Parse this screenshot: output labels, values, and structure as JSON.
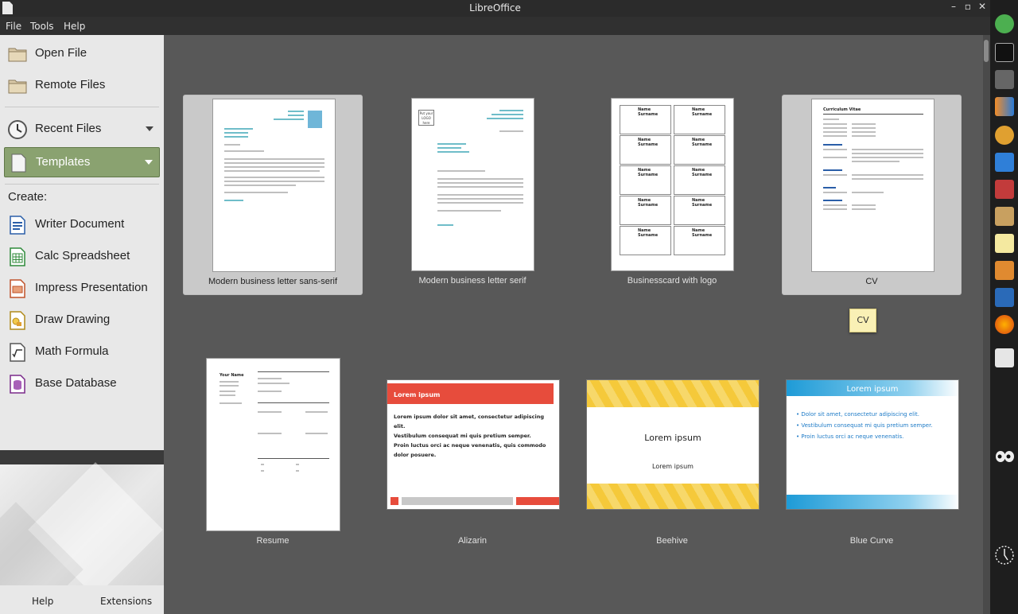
{
  "window": {
    "title": "LibreOffice",
    "minimize": "–",
    "maximize": "▫",
    "close": "✕"
  },
  "menu": {
    "items": [
      "File",
      "Tools",
      "Help"
    ]
  },
  "sidebar": {
    "open_file": "Open File",
    "remote_files": "Remote Files",
    "recent_files": "Recent Files",
    "templates": "Templates",
    "create_label": "Create:",
    "create_items": [
      "Writer Document",
      "Calc Spreadsheet",
      "Impress Presentation",
      "Draw Drawing",
      "Math Formula",
      "Base Database"
    ],
    "footer": {
      "help": "Help",
      "extensions": "Extensions"
    }
  },
  "templates": [
    {
      "name": "Modern business letter sans-serif",
      "selected": true
    },
    {
      "name": "Modern business letter serif",
      "selected": false
    },
    {
      "name": "Businesscard with logo",
      "selected": false
    },
    {
      "name": "CV",
      "selected": true
    },
    {
      "name": "Resume",
      "selected": false
    },
    {
      "name": "Alizarin",
      "selected": false
    },
    {
      "name": "Beehive",
      "selected": false
    },
    {
      "name": "Blue Curve",
      "selected": false
    }
  ],
  "thumbs": {
    "letter_logo": [
      "Put your",
      "LOGO",
      "here"
    ],
    "bizcard_name": "Name Surname",
    "cv_title": "Curriculum Vitae",
    "resume_name": "Your Name",
    "slide_title": "Lorem ipsum",
    "slide_bullets": [
      "Lorem ipsum dolor sit amet, consectetur adipiscing elit.",
      "Vestibulum consequat mi quis pretium semper.",
      "Proin luctus orci ac neque venenatis, quis commodo dolor posuere."
    ],
    "blue_bullets": [
      "Dolor sit amet, consectetur adipiscing elit.",
      "Vestibulum consequat mi quis pretium semper.",
      "Proin luctus orci ac neque venenatis."
    ]
  },
  "tooltip": "CV",
  "colors": {
    "accent": "#8aa270",
    "alizarin": "#e74c3c",
    "bluecurve": "#1e9bd7",
    "beehive": "#f5c93a"
  }
}
